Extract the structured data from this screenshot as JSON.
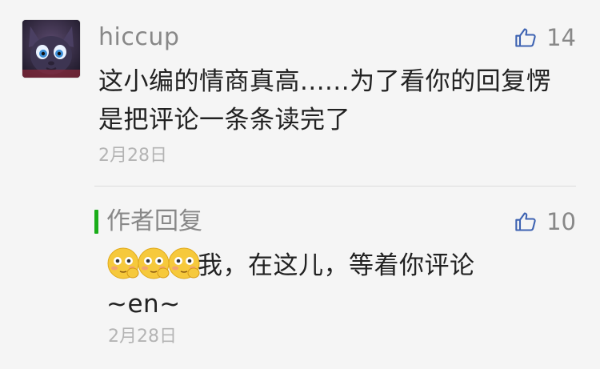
{
  "comment": {
    "nickname": "hiccup",
    "avatar_icon": "cat-avatar",
    "like_icon": "thumbs-up-icon",
    "like_count": "14",
    "text": "这小编的情商真高......为了看你的回复愣是把评论一条条读完了",
    "date": "2月28日"
  },
  "reply": {
    "label": "作者回复",
    "label_accent": "#1aad19",
    "like_icon": "thumbs-up-icon",
    "like_count": "10",
    "emoji_icons": [
      "shy-face-emoji",
      "shy-face-emoji",
      "shy-face-emoji"
    ],
    "text_line1": "我，在这儿，等着你评论",
    "text_line2": "~en~",
    "date": "2月28日"
  },
  "colors": {
    "background": "#f5f5f5",
    "meta_text": "#888888",
    "body_text": "#222222",
    "date_text": "#b4b4b4",
    "divider": "#dcdcdc"
  }
}
